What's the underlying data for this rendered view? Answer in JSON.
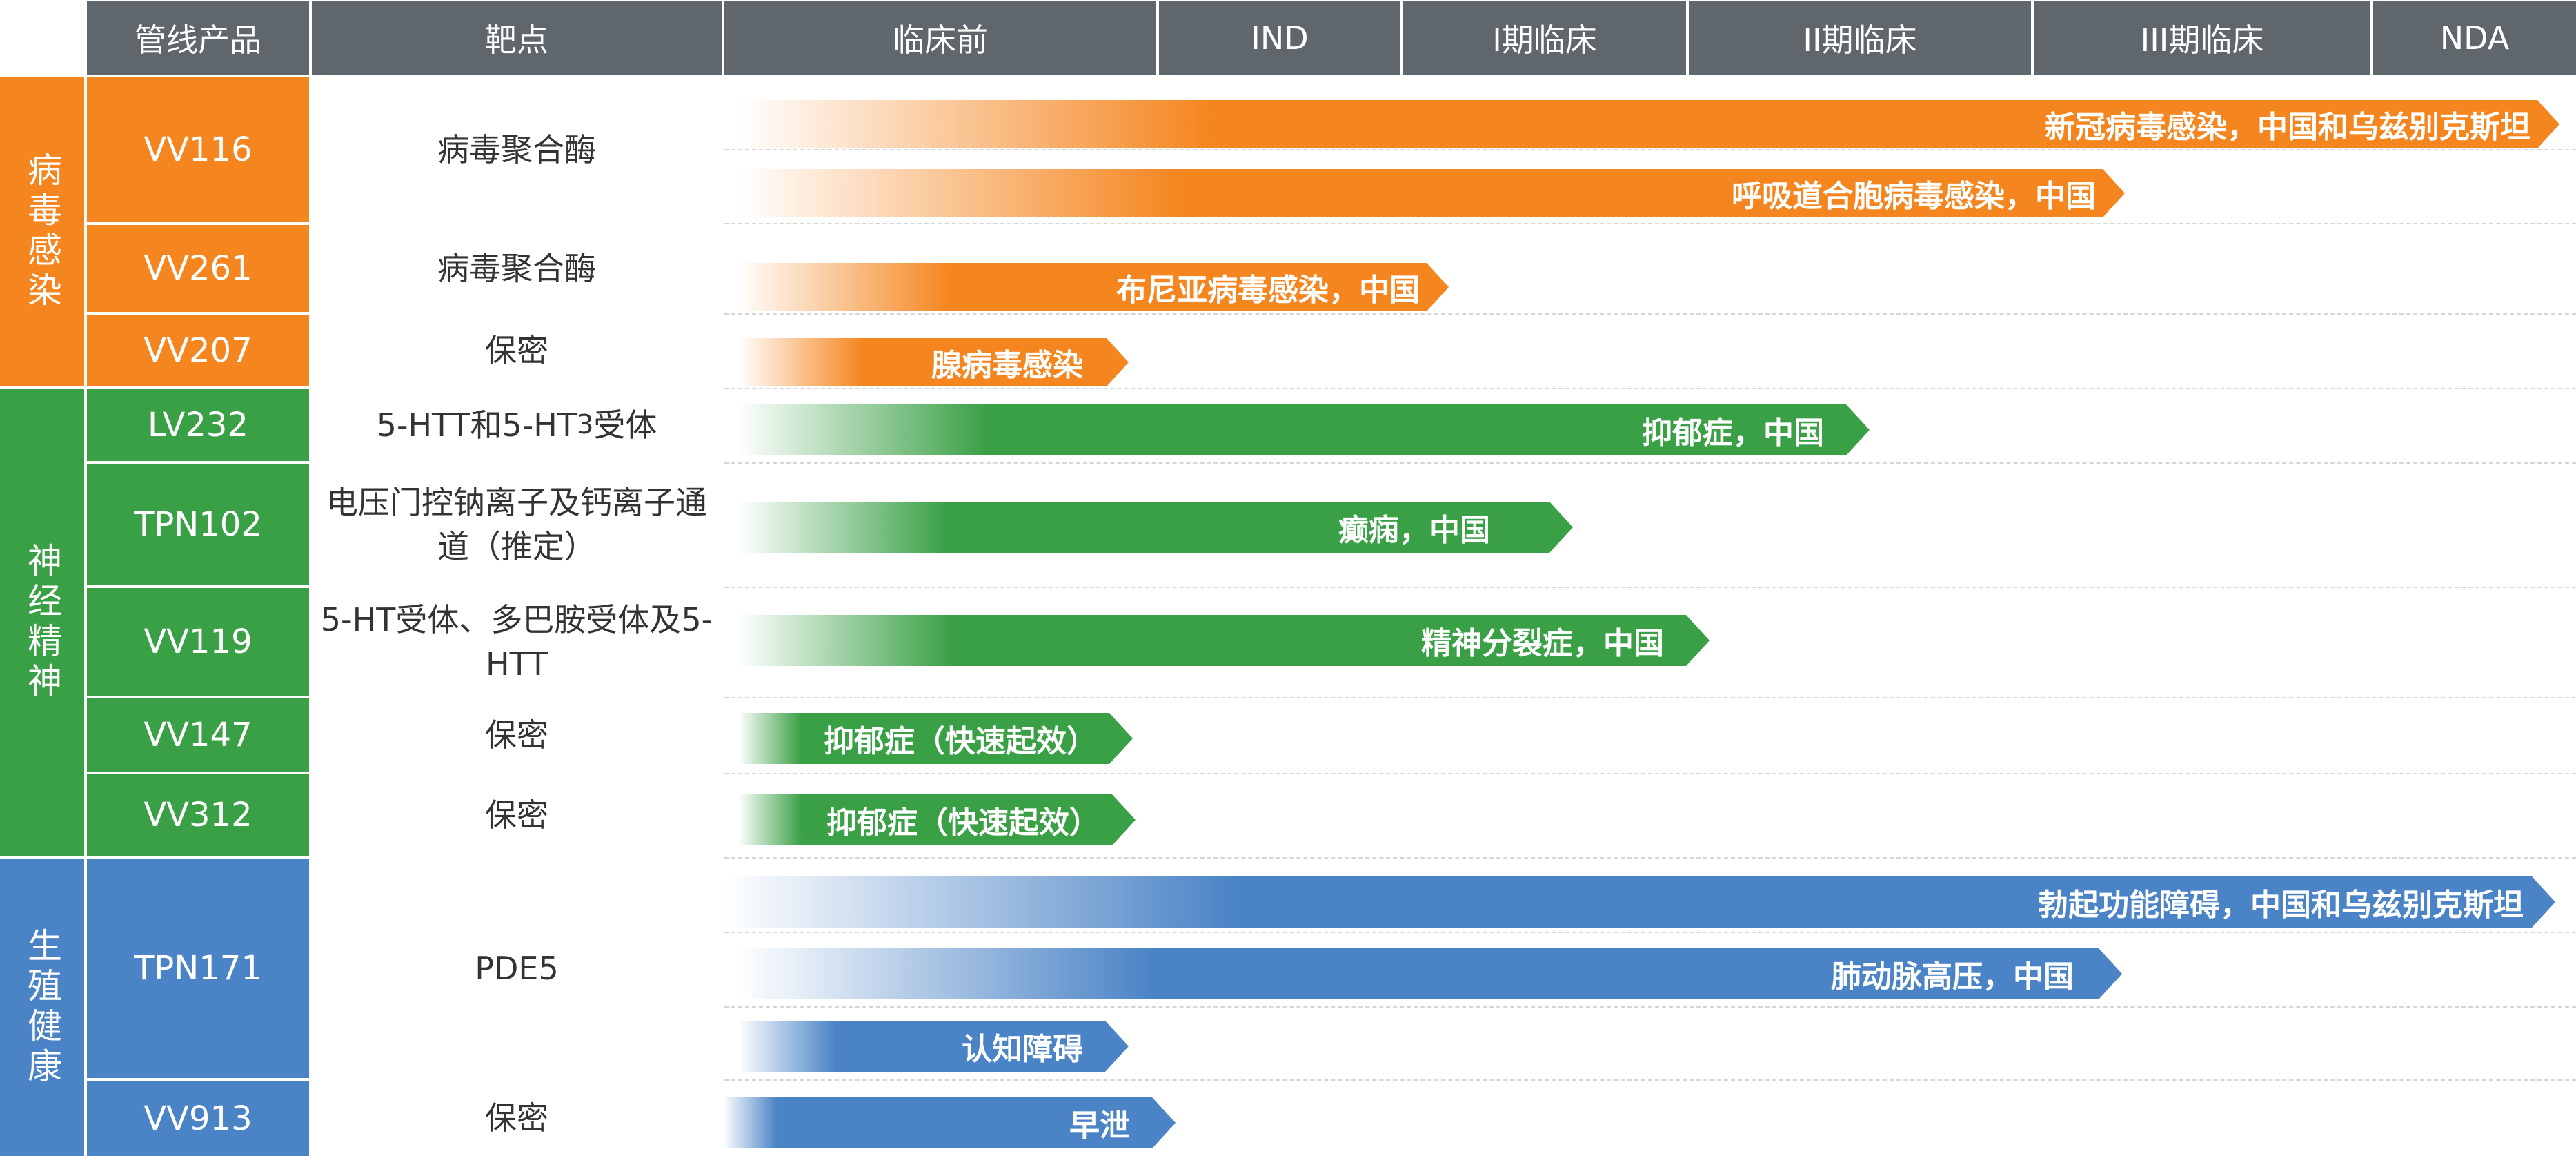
{
  "colors": {
    "header": "#5f666c",
    "virus": "#f5851f",
    "neuro": "#3aa046",
    "repro": "#4a83c6"
  },
  "header": {
    "product": "管线产品",
    "target": "靶点",
    "preclinical": "临床前",
    "ind": "IND",
    "phase1": "I期临床",
    "phase2": "II期临床",
    "phase3": "III期临床",
    "nda": "NDA"
  },
  "categories": [
    {
      "name": "病毒感染"
    },
    {
      "name": "神经精神"
    },
    {
      "name": "生殖健康"
    }
  ],
  "products": [
    {
      "name": "VV116",
      "target": "病毒聚合酶"
    },
    {
      "name": "VV261",
      "target": "病毒聚合酶"
    },
    {
      "name": "VV207",
      "target": "保密"
    },
    {
      "name": "LV232",
      "target_html": "5-HTT和5-HT<sub>3</sub>受体"
    },
    {
      "name": "TPN102",
      "target": "电压门控钠离子及钙离子通道（推定）"
    },
    {
      "name": "VV119",
      "target": "5-HT受体、多巴胺受体及5-HTT"
    },
    {
      "name": "VV147",
      "target": "保密"
    },
    {
      "name": "VV312",
      "target": "保密"
    },
    {
      "name": "TPN171",
      "target": "PDE5"
    },
    {
      "name": "VV913",
      "target": "保密"
    }
  ],
  "bars": [
    {
      "label": "新冠病毒感染，中国和乌兹别克斯坦",
      "category": "virus"
    },
    {
      "label": "呼吸道合胞病毒感染，中国",
      "category": "virus"
    },
    {
      "label": "布尼亚病毒感染，中国",
      "category": "virus"
    },
    {
      "label": "腺病毒感染",
      "category": "virus"
    },
    {
      "label": "抑郁症，中国",
      "category": "neuro"
    },
    {
      "label": "癫痫，中国",
      "category": "neuro"
    },
    {
      "label": "精神分裂症，中国",
      "category": "neuro"
    },
    {
      "label": "抑郁症（快速起效）",
      "category": "neuro"
    },
    {
      "label": "抑郁症（快速起效）",
      "category": "neuro"
    },
    {
      "label": "勃起功能障碍，中国和乌兹别克斯坦",
      "category": "repro"
    },
    {
      "label": "肺动脉高压，中国",
      "category": "repro"
    },
    {
      "label": "认知障碍",
      "category": "repro"
    },
    {
      "label": "早泄",
      "category": "repro"
    }
  ]
}
